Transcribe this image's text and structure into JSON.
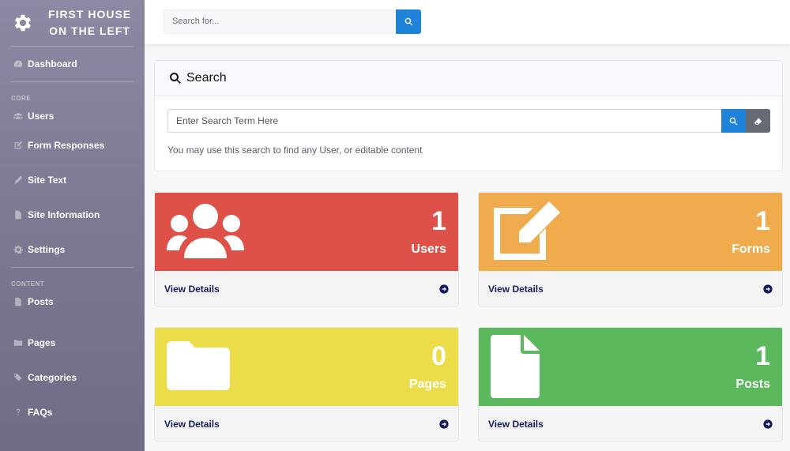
{
  "brand": {
    "line1": "FIRST HOUSE",
    "line2": "ON THE LEFT"
  },
  "sidebar": {
    "dashboard": "Dashboard",
    "core_heading": "CORE",
    "core_items": [
      {
        "label": "Users",
        "icon": "users-icon"
      },
      {
        "label": "Form Responses",
        "icon": "edit-icon"
      },
      {
        "label": "Site Text",
        "icon": "pencil-icon"
      },
      {
        "label": "Site Information",
        "icon": "file-icon"
      },
      {
        "label": "Settings",
        "icon": "gear-icon"
      }
    ],
    "content_heading": "CONTENT",
    "content_items": [
      {
        "label": "Posts",
        "icon": "file-icon"
      },
      {
        "label": "Pages",
        "icon": "folder-icon"
      },
      {
        "label": "Categories",
        "icon": "tags-icon"
      },
      {
        "label": "FAQs",
        "icon": "question-icon"
      }
    ]
  },
  "topbar": {
    "search_placeholder": "Search for..."
  },
  "search_card": {
    "title": "Search",
    "input_placeholder": "Enter Search Term Here",
    "help_text": "You may use this search to find any User, or editable content"
  },
  "stats": [
    {
      "count": "1",
      "label": "Users",
      "link": "View Details",
      "color": "#dd5149",
      "icon": "users-icon"
    },
    {
      "count": "1",
      "label": "Forms",
      "link": "View Details",
      "color": "#f0ab4c",
      "icon": "edit-icon"
    },
    {
      "count": "0",
      "label": "Pages",
      "link": "View Details",
      "color": "#ecdc4a",
      "icon": "folder-icon"
    },
    {
      "count": "1",
      "label": "Posts",
      "link": "View Details",
      "color": "#5cb85c",
      "icon": "file-icon"
    }
  ]
}
